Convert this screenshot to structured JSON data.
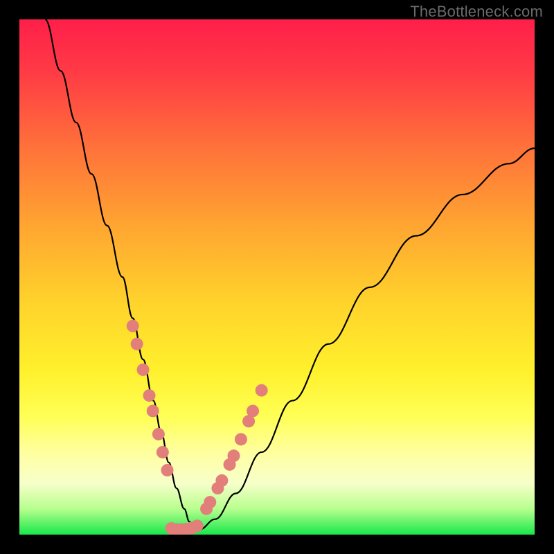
{
  "watermark": "TheBottleneck.com",
  "chart_data": {
    "type": "line",
    "title": "",
    "xlabel": "",
    "ylabel": "",
    "xlim": [
      0,
      100
    ],
    "ylim": [
      0,
      100
    ],
    "series": [
      {
        "name": "bottleneck-curve",
        "x": [
          5,
          8,
          11,
          14,
          17,
          20,
          22,
          24,
          26,
          27.5,
          29,
          30.5,
          32,
          33,
          34,
          35,
          38,
          42,
          47,
          53,
          60,
          68,
          77,
          86,
          95,
          100
        ],
        "y": [
          100,
          90,
          80,
          70,
          60,
          50,
          42,
          34,
          26,
          20,
          14,
          9,
          5,
          2.5,
          1,
          1,
          3,
          8,
          16,
          26,
          37,
          48,
          58,
          66,
          72,
          75
        ]
      }
    ],
    "highlight_points_left": {
      "name": "left-leg-markers",
      "x": [
        22.0,
        22.8,
        24.0,
        25.2,
        25.9,
        27.0,
        27.8,
        28.7
      ],
      "y": [
        40.5,
        37.0,
        32.0,
        27.0,
        24.0,
        19.5,
        16.0,
        12.5
      ]
    },
    "highlight_points_right": {
      "name": "right-leg-markers",
      "x": [
        36.3,
        37.0,
        38.5,
        39.3,
        40.8,
        41.6,
        43.0,
        44.5,
        45.3,
        47.0
      ],
      "y": [
        5.0,
        6.3,
        9.0,
        10.5,
        13.6,
        15.3,
        18.5,
        22.0,
        24.0,
        28.0
      ]
    },
    "bottom_highlight": {
      "name": "minimum-run",
      "x": [
        29.5,
        30.5,
        31.5,
        32.5,
        33.5,
        34.5
      ],
      "y": [
        1.2,
        1.0,
        1.0,
        1.1,
        1.3,
        1.7
      ]
    }
  }
}
